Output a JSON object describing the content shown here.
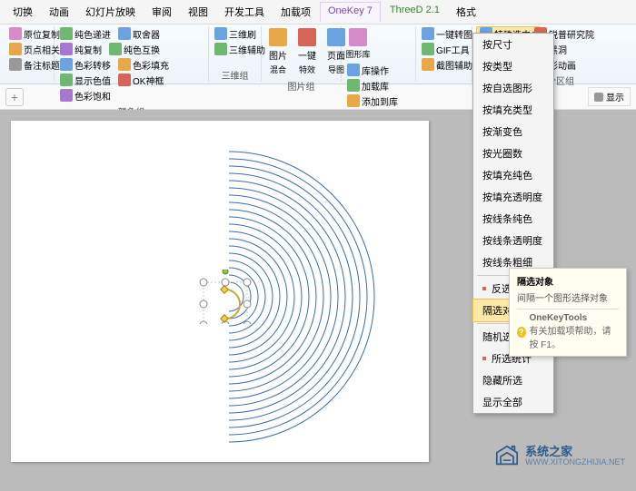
{
  "tabs": [
    "切换",
    "动画",
    "幻灯片放映",
    "审阅",
    "视图",
    "开发工具",
    "加载项",
    "OneKey 7",
    "ThreeD 2.1",
    "格式"
  ],
  "ribbon": {
    "g1": {
      "items": [
        "原位复制",
        "页点相关",
        "备注标题"
      ]
    },
    "g2": {
      "label": "颜色组",
      "items": [
        "纯色递进",
        "纯色互换",
        "显示色值",
        "取舍器",
        "色彩转移",
        "OK神框",
        "纯复制",
        "色彩填充",
        "色彩饱和"
      ]
    },
    "g3": {
      "label": "三维组",
      "items": [
        "三维刷",
        "三维辅助",
        "图片",
        "混合",
        "一键",
        "特效",
        "页面",
        "导图"
      ]
    },
    "g4": {
      "label": "图片组"
    },
    "g5": {
      "label": "图形库",
      "items": [
        "图形库",
        "库操作",
        "加载库",
        "添加到库"
      ]
    },
    "g6": {
      "items": [
        "一键转图",
        "GIF工具",
        "截图辅助"
      ]
    },
    "g7": {
      "items": [
        "特殊选中"
      ]
    },
    "g8": {
      "label": "分区组",
      "items": [
        "锐普研究院",
        "黑洞",
        "彩动画"
      ]
    }
  },
  "menu": {
    "items1": [
      "按尺寸",
      "按类型",
      "按自选图形",
      "按填充类型",
      "按渐变色",
      "按光圈数",
      "按填充纯色",
      "按填充透明度",
      "按线条纯色",
      "按线条透明度",
      "按线条粗细"
    ],
    "inverse": "反选对象",
    "highlighted": "隔选对象",
    "items2": [
      "随机选择",
      "所选统计",
      "隐藏所选",
      "显示全部"
    ]
  },
  "tooltip": {
    "title": "隔选对象",
    "desc": "间隔一个图形选择对象",
    "brand": "OneKeyTools",
    "help": "有关加载项帮助，请按 F1。"
  },
  "subribbon": {
    "plus": "+",
    "display": "显示"
  },
  "watermark": {
    "name": "系统之家",
    "url": "WWW.XITONGZHIJIA.NET"
  }
}
